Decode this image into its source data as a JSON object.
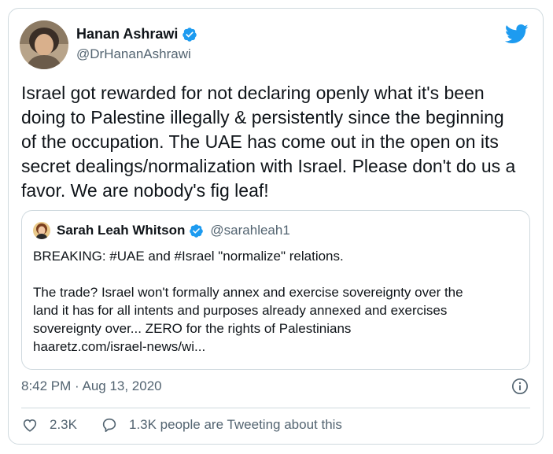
{
  "tweet": {
    "author_name": "Hanan Ashrawi",
    "author_handle": "@DrHananAshrawi",
    "text": "Israel got rewarded for not declaring openly what it's been\ndoing to Palestine illegally & persistently since the beginning\nof the occupation. The UAE has come out in the open on its\nsecret dealings/normalization with Israel. Please don't do us a\nfavor. We are nobody's fig leaf!",
    "timestamp": "8:42 PM · Aug 13, 2020",
    "likes": "2.3K",
    "tweeting_about": "1.3K people are Tweeting about this"
  },
  "quoted": {
    "author_name": "Sarah Leah Whitson",
    "author_handle": "@sarahleah1",
    "text": "BREAKING: #UAE and #Israel \"normalize\" relations.\n\nThe trade? Israel won't formally annex and exercise sovereignty over the\nland it has for all intents and purposes already annexed and exercises\nsovereignty over... ZERO for the rights of Palestinians\nhaaretz.com/israel-news/wi..."
  },
  "colors": {
    "accent": "#1d9bf0",
    "text": "#0f1419",
    "secondary": "#536471",
    "border": "#cfd9de"
  },
  "icons": {
    "brand": "twitter-bird-icon",
    "verified": "verified-badge-icon",
    "info": "info-icon",
    "like": "heart-icon",
    "reply": "speech-bubble-icon"
  }
}
